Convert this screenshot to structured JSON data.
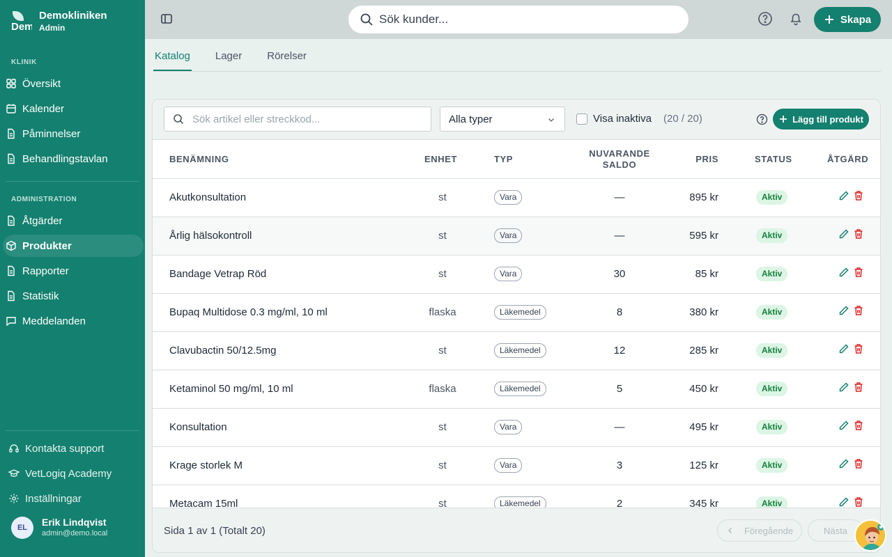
{
  "brand": {
    "name": "Demokliniken",
    "role": "Admin",
    "logo_text": "Dem"
  },
  "sidebar": {
    "section_klinik": "KLINIK",
    "section_admin": "ADMINISTRATION",
    "items": [
      {
        "label": "Översikt",
        "icon": "grid-icon"
      },
      {
        "label": "Kalender",
        "icon": "calendar-icon"
      },
      {
        "label": "Påminnelser",
        "icon": "document-icon"
      },
      {
        "label": "Behandlingstavlan",
        "icon": "document-icon"
      }
    ],
    "admin_items": [
      {
        "label": "Åtgärder",
        "icon": "document-icon"
      },
      {
        "label": "Produkter",
        "icon": "box-icon",
        "active": true
      },
      {
        "label": "Rapporter",
        "icon": "document-icon"
      },
      {
        "label": "Statistik",
        "icon": "document-icon"
      },
      {
        "label": "Meddelanden",
        "icon": "message-icon"
      }
    ],
    "footer_items": [
      {
        "label": "Kontakta support",
        "icon": "headset-icon"
      },
      {
        "label": "VetLogiq Academy",
        "icon": "graduation-cap-icon"
      },
      {
        "label": "Inställningar",
        "icon": "gear-icon"
      }
    ],
    "user": {
      "initials": "EL",
      "name": "Erik Lindqvist",
      "email": "admin@demo.local"
    }
  },
  "topbar": {
    "search_placeholder": "Sök kunder...",
    "create_label": "Skapa"
  },
  "tabs": [
    {
      "label": "Katalog",
      "active": true
    },
    {
      "label": "Lager"
    },
    {
      "label": "Rörelser"
    }
  ],
  "toolbar": {
    "search_placeholder": "Sök artikel eller streckkod...",
    "type_select": "Alla typer",
    "show_inactive": "Visa inaktiva",
    "count": "(20 / 20)",
    "add_label": "Lägg till produkt"
  },
  "table": {
    "headers": {
      "name": "BENÄMNING",
      "unit": "ENHET",
      "type": "TYP",
      "saldo_1": "NUVARANDE",
      "saldo_2": "SALDO",
      "price": "PRIS",
      "status": "STATUS",
      "action": "ÅTGÄRD"
    },
    "rows": [
      {
        "name": "Akutkonsultation",
        "unit": "st",
        "type": "Vara",
        "saldo": "—",
        "price": "895 kr",
        "status": "Aktiv"
      },
      {
        "name": "Årlig hälsokontroll",
        "unit": "st",
        "type": "Vara",
        "saldo": "—",
        "price": "595 kr",
        "status": "Aktiv"
      },
      {
        "name": "Bandage Vetrap Röd",
        "unit": "st",
        "type": "Vara",
        "saldo": "30",
        "price": "85 kr",
        "status": "Aktiv"
      },
      {
        "name": "Bupaq Multidose 0.3 mg/ml, 10 ml",
        "unit": "flaska",
        "type": "Läkemedel",
        "saldo": "8",
        "price": "380 kr",
        "status": "Aktiv"
      },
      {
        "name": "Clavubactin 50/12.5mg",
        "unit": "st",
        "type": "Läkemedel",
        "saldo": "12",
        "price": "285 kr",
        "status": "Aktiv"
      },
      {
        "name": "Ketaminol 50 mg/ml, 10 ml",
        "unit": "flaska",
        "type": "Läkemedel",
        "saldo": "5",
        "price": "450 kr",
        "status": "Aktiv"
      },
      {
        "name": "Konsultation",
        "unit": "st",
        "type": "Vara",
        "saldo": "—",
        "price": "495 kr",
        "status": "Aktiv"
      },
      {
        "name": "Krage storlek M",
        "unit": "st",
        "type": "Vara",
        "saldo": "3",
        "price": "125 kr",
        "status": "Aktiv"
      },
      {
        "name": "Metacam 15ml",
        "unit": "st",
        "type": "Läkemedel",
        "saldo": "2",
        "price": "345 kr",
        "status": "Aktiv"
      }
    ]
  },
  "pagination": {
    "info": "Sida 1 av 1 (Totalt 20)",
    "prev": "Föregående",
    "next": "Nästa"
  },
  "colors": {
    "primary": "#14806f",
    "status_bg": "#dcf5e4",
    "status_text": "#15803d",
    "delete": "#dc2626"
  }
}
